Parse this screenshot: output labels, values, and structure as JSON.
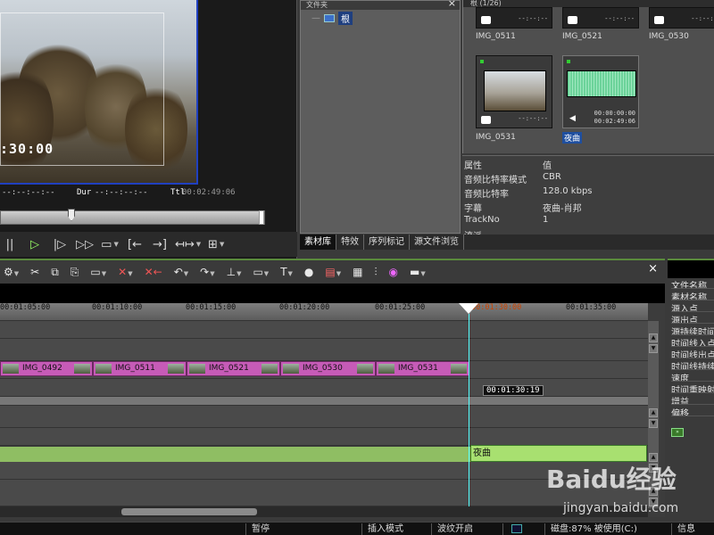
{
  "player": {
    "timecode_big": ":30:00",
    "in_point": "--:--:--:--",
    "dur_label": "Dur",
    "dur_value": "--:--:--:--",
    "ttl_label": "Ttl",
    "ttl_value": "00:02:49:06",
    "controls": [
      "stop-icon",
      "play-icon",
      "next-frame-icon",
      "fast-forward-icon",
      "loop-icon",
      "mark-in-icon",
      "mark-out-icon",
      "split-icon",
      "settings-icon"
    ]
  },
  "folder_panel": {
    "title": "文件夹",
    "root": "根"
  },
  "bin": {
    "header": "根 (1/26)",
    "clips": [
      {
        "name": "IMG_0511",
        "dash": "--:--:--"
      },
      {
        "name": "IMG_0521",
        "dash": "--:--:--"
      },
      {
        "name": "IMG_0530",
        "dash": "--:--:--"
      },
      {
        "name": "IMG_0531",
        "dash": "--:--:--"
      },
      {
        "name": "夜曲",
        "tc1": "00:00:00:00",
        "tc2": "00:02:49:06"
      }
    ]
  },
  "properties": {
    "col_key": "属性",
    "col_value": "值",
    "rows": [
      {
        "k": "音频比特率模式",
        "v": "CBR"
      },
      {
        "k": "音频比特率",
        "v": "128.0 kbps"
      },
      {
        "k": "字幕",
        "v": "夜曲-肖邦"
      },
      {
        "k": "TrackNo",
        "v": "1"
      },
      {
        "k": "流派",
        "v": ""
      }
    ]
  },
  "tabs": [
    "素材库",
    "特效",
    "序列标记",
    "源文件浏览"
  ],
  "timeline": {
    "ruler": [
      "00:01:05:00",
      "00:01:10:00",
      "00:01:15:00",
      "00:01:20:00",
      "00:01:25:00",
      "00:01:30:00",
      "00:01:35:00"
    ],
    "clips": [
      "IMG_0492",
      "IMG_0511",
      "IMG_0521",
      "IMG_0530",
      "IMG_0531"
    ],
    "cursor_tc": "00:01:30:19",
    "audio_clip": "夜曲"
  },
  "info_panel": {
    "rows": [
      "文件名称",
      "素材名称",
      "源入点",
      "源出点",
      "源持续时间",
      "时间线入点",
      "时间线出点",
      "时间线持续时间",
      "速度",
      "时间重映射",
      "增益",
      "偏移"
    ]
  },
  "status": {
    "paused": "暂停",
    "insert_mode": "插入模式",
    "ripple": "波纹开启",
    "disk": "磁盘:87% 被使用(C:)",
    "info": "信息"
  },
  "watermark": {
    "logo": "Baidu经验",
    "url": "jingyan.baidu.com"
  }
}
